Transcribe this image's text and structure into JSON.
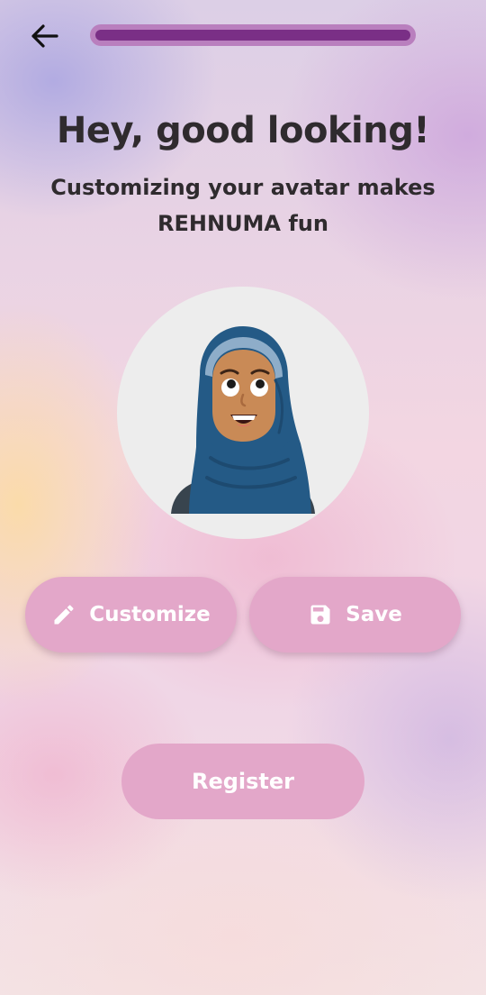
{
  "header": {
    "back_icon": "arrow-left-icon",
    "progress": 1.0,
    "progress_track_color": "#b97fbe",
    "progress_fill_color": "#7a2f86"
  },
  "intro": {
    "title": "Hey, good looking!",
    "subtitle": "Customizing your avatar makes REHNUMA fun"
  },
  "avatar": {
    "description_icon": "hijab-avatar",
    "background_color": "#ededed"
  },
  "actions": {
    "customize_label": "Customize",
    "customize_icon": "pencil-icon",
    "save_label": "Save",
    "save_icon": "floppy-disk-icon",
    "register_label": "Register",
    "button_color": "#e3a7c9"
  }
}
